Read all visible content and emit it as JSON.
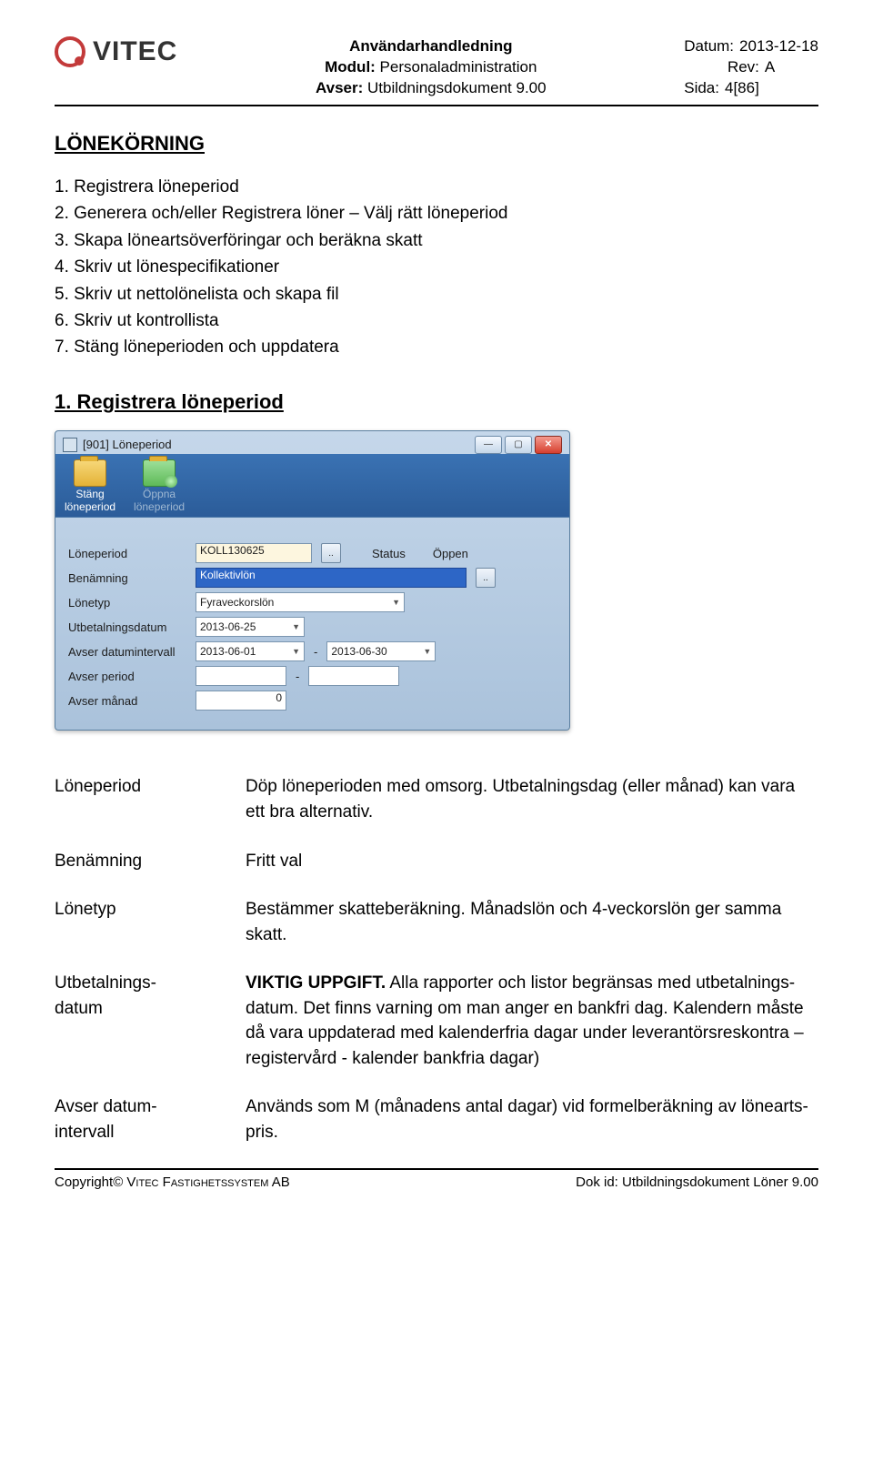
{
  "header": {
    "logo_text": "VITEC",
    "center_line1": "Användarhandledning",
    "center_line2_label": "Modul: ",
    "center_line2_value": "Personaladministration",
    "center_line3_label": "Avser: ",
    "center_line3_value": "Utbildningsdokument 9.00",
    "date_label": "Datum:",
    "date_value": "2013-12-18",
    "rev_label": "Rev:",
    "rev_value": "A",
    "page_label": "Sida:",
    "page_value": "4[86]"
  },
  "section_title": "LÖNEKÖRNING",
  "steps": [
    "1.  Registrera löneperiod",
    "2.  Generera och/eller Registrera löner – Välj rätt löneperiod",
    "3.  Skapa löneartsöverföringar och beräkna skatt",
    "4.  Skriv ut lönespecifikationer",
    "5.  Skriv ut nettolönelista och skapa fil",
    "6.  Skriv ut kontrollista",
    "7.  Stäng löneperioden och uppdatera"
  ],
  "sub_title": "1. Registrera löneperiod",
  "appwin": {
    "title": "[901] Löneperiod",
    "tool_close_l1": "Stäng",
    "tool_close_l2": "löneperiod",
    "tool_open_l1": "Öppna",
    "tool_open_l2": "löneperiod",
    "labels": {
      "loneperiod": "Löneperiod",
      "status": "Status",
      "benamning": "Benämning",
      "lonetyp": "Lönetyp",
      "utbetdatum": "Utbetalningsdatum",
      "avser_interval": "Avser datumintervall",
      "avser_period": "Avser period",
      "avser_manad": "Avser månad"
    },
    "values": {
      "loneperiod": "KOLL130625",
      "status": "Öppen",
      "benamning": "Kollektivlön",
      "lonetyp": "Fyraveckorslön",
      "utbetdatum": "2013-06-25",
      "interval_from": "2013-06-01",
      "interval_to": "2013-06-30",
      "avser_period_from": "",
      "avser_period_to": "",
      "avser_manad": "0",
      "interval_sep": "-"
    }
  },
  "defs": {
    "loneperiod_term": "Löneperiod",
    "loneperiod_desc": "Döp löneperioden med omsorg. Utbetalningsdag (eller månad) kan vara ett bra alternativ.",
    "benamning_term": "Benämning",
    "benamning_desc": "Fritt val",
    "lonetyp_term": "Lönetyp",
    "lonetyp_desc": "Bestämmer skatteberäkning. Månadslön och 4-veckorslön ger samma skatt.",
    "utbet_term_l1": "Utbetalnings-",
    "utbet_term_l2": "datum",
    "utbet_desc_bold": "VIKTIG UPPGIFT.",
    "utbet_desc_rest": " Alla rapporter och listor begränsas med utbetalnings-datum. Det finns varning om man anger en bankfri dag. Kalendern måste då vara uppdaterad med kalenderfria dagar under leverantörsreskontra – registervård - kalender bankfria dagar)",
    "avser_term_l1": "Avser datum-",
    "avser_term_l2": "intervall",
    "avser_desc": "Används som M (månadens antal dagar) vid formelberäkning av lönearts-pris."
  },
  "footer": {
    "left_prefix": "Copyright© ",
    "left_company": "Vitec Fastighetssystem AB",
    "right_label": "Dok id: ",
    "right_value": "Utbildningsdokument Löner 9.00"
  }
}
